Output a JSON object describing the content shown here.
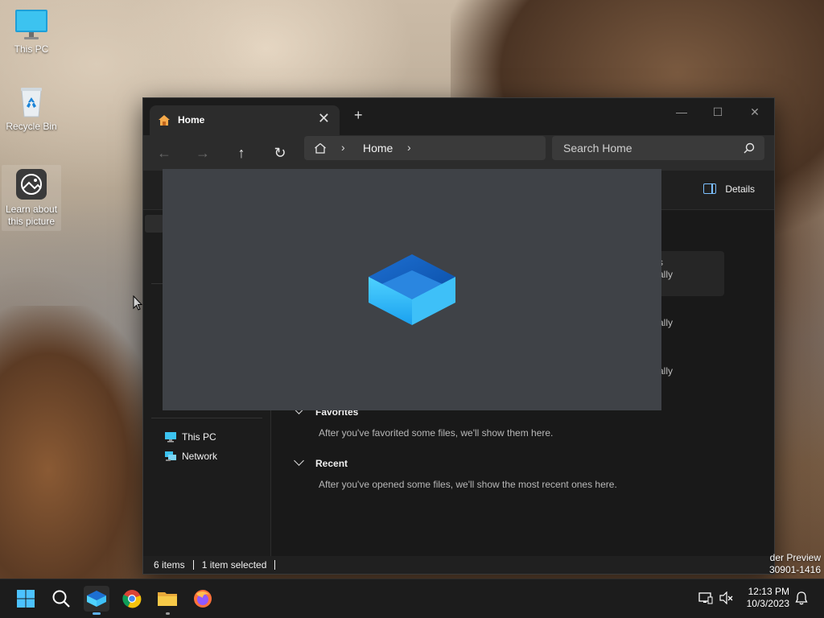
{
  "desktop": {
    "icons": [
      {
        "label": "This PC",
        "icon": "monitor-icon"
      },
      {
        "label": "Recycle Bin",
        "icon": "recycle-bin-icon"
      },
      {
        "label": "Learn about this picture",
        "icon": "picture-info-icon"
      }
    ],
    "watermark": {
      "line1": "der Preview",
      "line2": "30901-1416"
    }
  },
  "explorer": {
    "tab": {
      "title": "Home",
      "icon": "home-icon"
    },
    "new_tab_glyph": "+",
    "window_controls": {
      "minimize": "—",
      "maximize": "☐",
      "close": "✕"
    },
    "nav": {
      "back": "←",
      "forward": "→",
      "up": "↑",
      "refresh": "↻"
    },
    "breadcrumb": {
      "root_icon": "home-icon",
      "current": "Home"
    },
    "search": {
      "placeholder": "Search Home"
    },
    "commandbar": {
      "details_label": "Details"
    },
    "sidebar": {
      "items": [
        {
          "label": "This PC",
          "icon": "monitor-icon"
        },
        {
          "label": "Network",
          "icon": "network-icon"
        }
      ]
    },
    "main": {
      "partial_quick_access": [
        "s",
        "ally",
        "ally",
        "ally"
      ],
      "sections": [
        {
          "title": "Favorites",
          "message": "After you've favorited some files, we'll show them here."
        },
        {
          "title": "Recent",
          "message": "After you've opened some files, we'll show the most recent ones here."
        }
      ]
    },
    "status": {
      "items": "6 items",
      "selected": "1 item selected"
    }
  },
  "splash": {
    "icon": "file-explorer-app-icon"
  },
  "taskbar": {
    "apps": [
      "start-icon",
      "search-icon",
      "file-explorer-icon",
      "chrome-icon",
      "folder-icon",
      "firefox-icon"
    ],
    "clock": {
      "time": "12:13 PM",
      "date": "10/3/2023"
    }
  },
  "colors": {
    "accent": "#5fb2f2",
    "window_bg": "#202020",
    "splash_bg": "#3f4247"
  }
}
